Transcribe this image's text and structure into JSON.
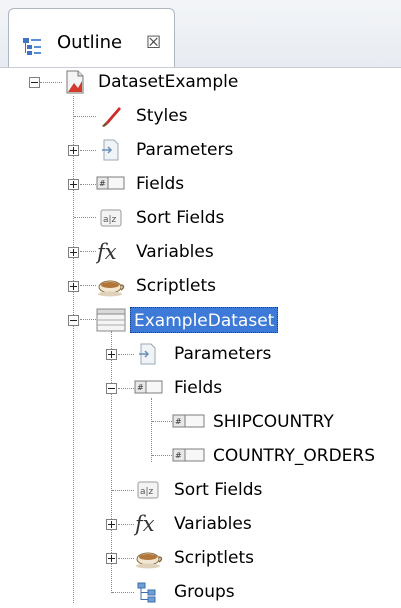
{
  "tab": {
    "title": "Outline",
    "icon": "outline-view-icon",
    "close_icon": "close-tab-icon",
    "close_glyph": "☒"
  },
  "tree": {
    "root": {
      "label": "DatasetExample",
      "icon": "report-icon"
    },
    "items": [
      {
        "label": "Styles",
        "icon": "styles-icon"
      },
      {
        "label": "Parameters",
        "icon": "parameters-icon"
      },
      {
        "label": "Fields",
        "icon": "fields-icon"
      },
      {
        "label": "Sort Fields",
        "icon": "sort-fields-icon"
      },
      {
        "label": "Variables",
        "icon": "variables-icon"
      },
      {
        "label": "Scriptlets",
        "icon": "scriptlets-icon"
      },
      {
        "label": "ExampleDataset",
        "icon": "dataset-icon",
        "selected": true
      }
    ],
    "dataset_children": [
      {
        "label": "Parameters",
        "icon": "parameters-icon"
      },
      {
        "label": "Fields",
        "icon": "fields-icon"
      },
      {
        "label": "Sort Fields",
        "icon": "sort-fields-icon"
      },
      {
        "label": "Variables",
        "icon": "variables-icon"
      },
      {
        "label": "Scriptlets",
        "icon": "scriptlets-icon"
      },
      {
        "label": "Groups",
        "icon": "groups-icon"
      }
    ],
    "field_items": [
      {
        "label": "SHIPCOUNTRY",
        "icon": "field-icon"
      },
      {
        "label": "COUNTRY_ORDERS",
        "icon": "field-icon"
      }
    ]
  },
  "colors": {
    "selection": "#3d79d6",
    "selection_text": "#ffffff",
    "guide": "#8a8a8a"
  }
}
